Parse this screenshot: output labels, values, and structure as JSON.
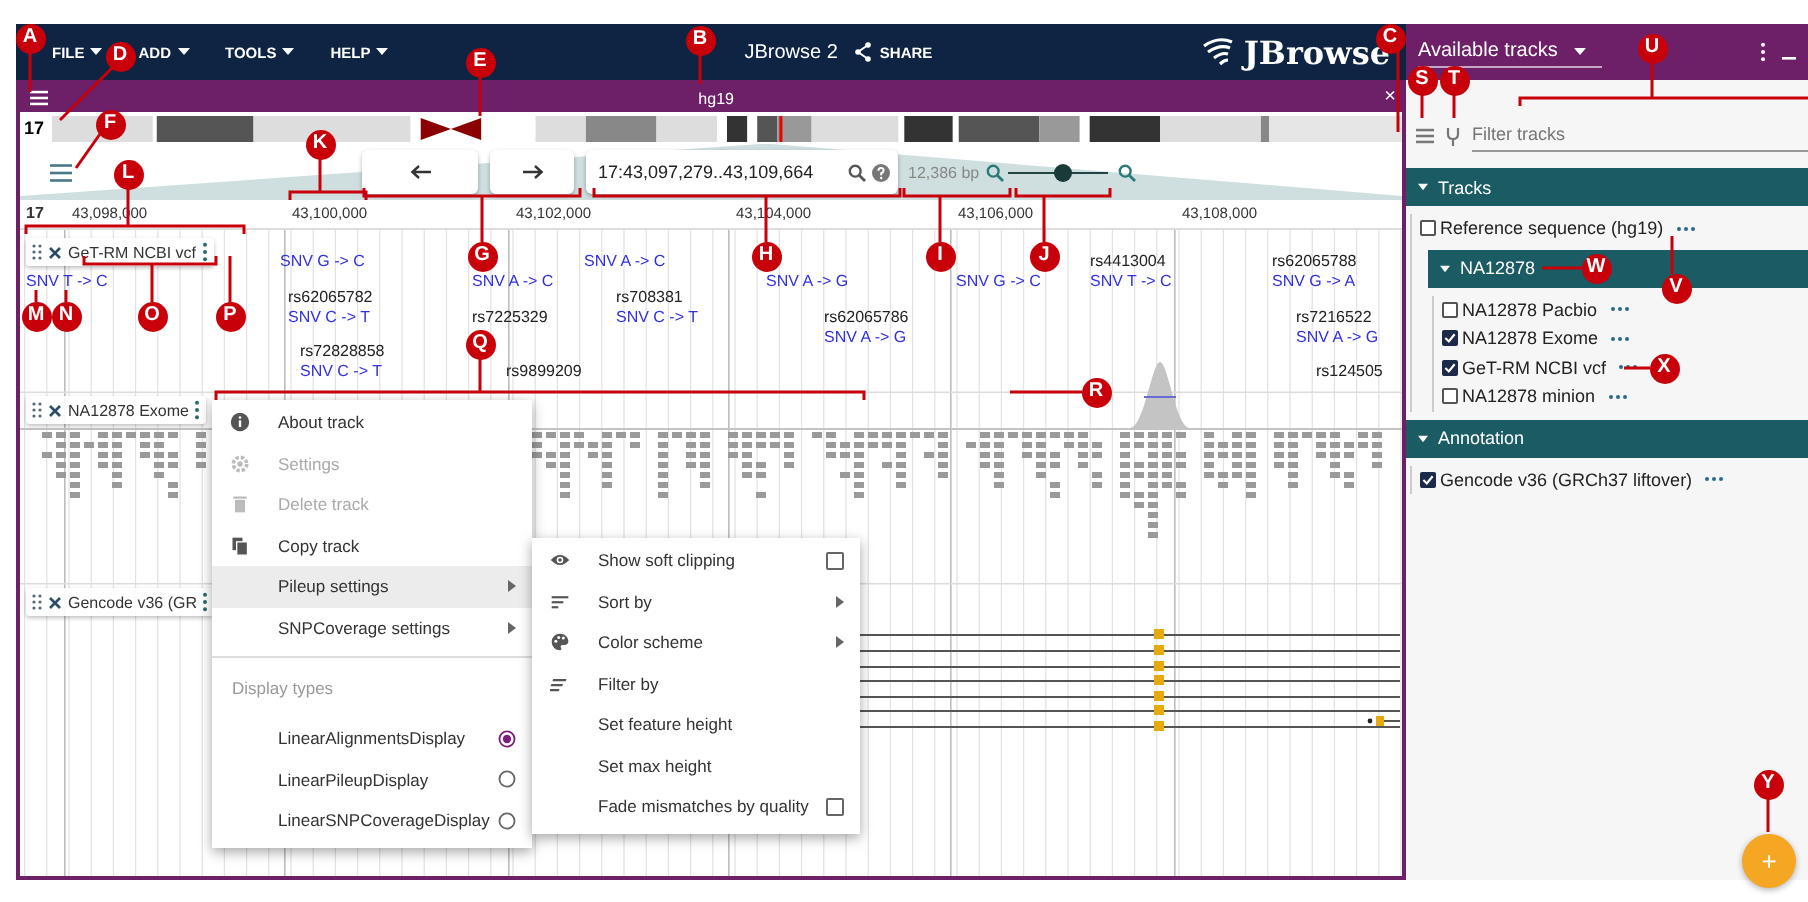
{
  "annotations": [
    {
      "letter": "A"
    },
    {
      "letter": "B"
    },
    {
      "letter": "C"
    },
    {
      "letter": "D"
    },
    {
      "letter": "E"
    },
    {
      "letter": "F"
    },
    {
      "letter": "G"
    },
    {
      "letter": "H"
    },
    {
      "letter": "I"
    },
    {
      "letter": "J"
    },
    {
      "letter": "K"
    },
    {
      "letter": "L"
    },
    {
      "letter": "M"
    },
    {
      "letter": "N"
    },
    {
      "letter": "O"
    },
    {
      "letter": "P"
    },
    {
      "letter": "Q"
    },
    {
      "letter": "R"
    },
    {
      "letter": "S"
    },
    {
      "letter": "T"
    },
    {
      "letter": "U"
    },
    {
      "letter": "V"
    },
    {
      "letter": "W"
    },
    {
      "letter": "X"
    },
    {
      "letter": "Y"
    }
  ],
  "app_bar": {
    "menus": [
      {
        "label": "FILE"
      },
      {
        "label": "ADD"
      },
      {
        "label": "TOOLS"
      },
      {
        "label": "HELP"
      }
    ],
    "title": "JBrowse 2",
    "share": "SHARE",
    "logo": "JBrowse"
  },
  "view": {
    "assembly": "hg19",
    "close": "×",
    "chromosome": "17",
    "location": "17:43,097,279..43,109,664",
    "span": "12,386 bp",
    "zoom": {
      "level": 0.55
    },
    "ruler": [
      "17",
      "43,098,000",
      "43,100,000",
      "43,102,000",
      "43,104,000",
      "43,106,000",
      "43,108,000"
    ],
    "tracks": [
      {
        "label": "GeT-RM NCBI vcf",
        "kind": "variants",
        "features": [
          {
            "text": "SNV T -> C",
            "kind": "change"
          },
          {
            "text": "SNV G -> C",
            "kind": "change"
          },
          {
            "text": "rs62065782",
            "kind": "id"
          },
          {
            "text": "SNV C -> T",
            "kind": "change"
          },
          {
            "text": "rs72828858",
            "kind": "id"
          },
          {
            "text": "SNV C -> T",
            "kind": "change"
          },
          {
            "text": "SNV A -> C",
            "kind": "change"
          },
          {
            "text": "rs7225329",
            "kind": "id"
          },
          {
            "text": "rs9899209",
            "kind": "id"
          },
          {
            "text": "SNV A -> C",
            "kind": "change"
          },
          {
            "text": "rs708381",
            "kind": "id"
          },
          {
            "text": "SNV C -> T",
            "kind": "change"
          },
          {
            "text": "SNV A -> G",
            "kind": "change"
          },
          {
            "text": "rs62065786",
            "kind": "id"
          },
          {
            "text": "SNV A -> G",
            "kind": "change"
          },
          {
            "text": "SNV G -> C",
            "kind": "change"
          },
          {
            "text": "rs4413004",
            "kind": "id"
          },
          {
            "text": "SNV T -> C",
            "kind": "change"
          },
          {
            "text": "rs62065788",
            "kind": "id"
          },
          {
            "text": "SNV G -> A",
            "kind": "change"
          },
          {
            "text": "rs7216522",
            "kind": "id"
          },
          {
            "text": "SNV A -> G",
            "kind": "change"
          },
          {
            "text": "rs124505",
            "kind": "id"
          }
        ]
      },
      {
        "label": "NA12878 Exome",
        "kind": "alignments"
      },
      {
        "label": "Gencode v36 (GR",
        "kind": "genes"
      }
    ]
  },
  "track_menu": {
    "items": [
      {
        "label": "About track",
        "kind": "action",
        "disabled": false,
        "submenu": false,
        "selected": false
      },
      {
        "label": "Settings",
        "kind": "action",
        "disabled": true,
        "submenu": false,
        "selected": false
      },
      {
        "label": "Delete track",
        "kind": "action",
        "disabled": true,
        "submenu": false,
        "selected": false
      },
      {
        "label": "Copy track",
        "kind": "action",
        "disabled": false,
        "submenu": false,
        "selected": false
      },
      {
        "label": "Pileup settings",
        "kind": "action",
        "disabled": false,
        "submenu": true,
        "selected": true
      },
      {
        "label": "SNPCoverage settings",
        "kind": "action",
        "disabled": false,
        "submenu": true,
        "selected": false
      },
      {
        "label": "Display types",
        "kind": "header"
      },
      {
        "label": "LinearAlignmentsDisplay",
        "kind": "radio",
        "selected": true
      },
      {
        "label": "LinearPileupDisplay",
        "kind": "radio",
        "selected": false
      },
      {
        "label": "LinearSNPCoverageDisplay",
        "kind": "radio",
        "selected": false
      }
    ]
  },
  "pileup_submenu": {
    "items": [
      {
        "label": "Show soft clipping",
        "kind": "checkbox",
        "checked": false
      },
      {
        "label": "Sort by",
        "kind": "action",
        "submenu": true
      },
      {
        "label": "Color scheme",
        "kind": "action",
        "submenu": true
      },
      {
        "label": "Filter by",
        "kind": "action",
        "submenu": false
      },
      {
        "label": "Set feature height",
        "kind": "action",
        "submenu": false
      },
      {
        "label": "Set max height",
        "kind": "action",
        "submenu": false
      },
      {
        "label": "Fade mismatches by quality",
        "kind": "checkbox",
        "checked": false
      }
    ]
  },
  "track_selector": {
    "title": "Available tracks",
    "filter_placeholder": "Filter tracks",
    "categories": [
      {
        "name": "Tracks",
        "expanded": true,
        "tracks": [
          {
            "label": "Reference sequence (hg19)",
            "checked": false
          }
        ],
        "subcategories": [
          {
            "name": "NA12878",
            "expanded": true,
            "tracks": [
              {
                "label": "NA12878 Pacbio",
                "checked": false
              },
              {
                "label": "NA12878 Exome",
                "checked": true
              },
              {
                "label": "GeT-RM NCBI vcf",
                "checked": true
              },
              {
                "label": "NA12878 minion",
                "checked": false
              }
            ]
          }
        ]
      },
      {
        "name": "Annotation",
        "expanded": true,
        "tracks": [
          {
            "label": "Gencode v36 (GRCh37 liftover)",
            "checked": true
          }
        ]
      }
    ]
  },
  "fab": {
    "label": "+"
  }
}
